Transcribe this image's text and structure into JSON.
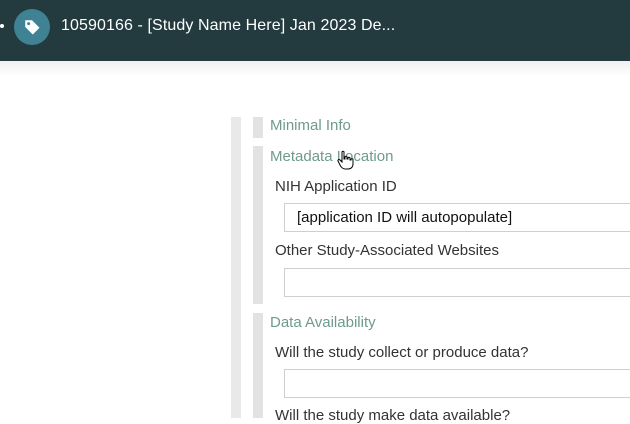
{
  "header": {
    "title": "10590166 - [Study Name Here] Jan 2023 De...",
    "tag_icon": "tag-icon",
    "colors": {
      "bar": "#233a3f",
      "badge": "#3f8294"
    }
  },
  "form": {
    "sections": [
      {
        "title": "Minimal Info"
      },
      {
        "title": "Metadata Location",
        "fields": [
          {
            "label": "NIH Application ID",
            "value": "[application ID will autopopulate]"
          },
          {
            "label": "Other Study-Associated Websites",
            "value": ""
          }
        ]
      },
      {
        "title": "Data Availability",
        "fields": [
          {
            "label": "Will the study collect or produce data?",
            "value": ""
          },
          {
            "label": "Will the study make data available?"
          }
        ]
      }
    ],
    "colors": {
      "section_title": "#6f9a8f"
    }
  },
  "cursor": {
    "icon": "hand-pointer-icon"
  }
}
